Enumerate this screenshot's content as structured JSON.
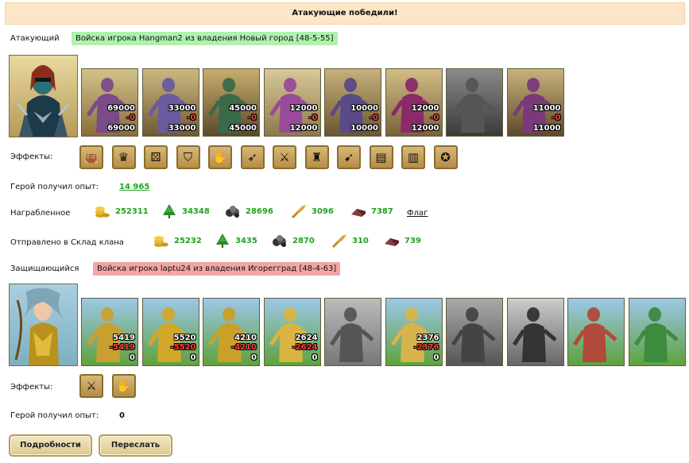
{
  "banner": "Атакующие победили!",
  "attacker": {
    "label": "Атакующий",
    "army": "Войска игрока Hangman2 из владения Новый город [48-5-55]",
    "units": [
      {
        "name": "unit-1",
        "total": "69000",
        "lost": "-0",
        "left": "69000"
      },
      {
        "name": "unit-2",
        "total": "33000",
        "lost": "-0",
        "left": "33000"
      },
      {
        "name": "unit-3",
        "total": "45000",
        "lost": "-0",
        "left": "45000"
      },
      {
        "name": "unit-4",
        "total": "12000",
        "lost": "-0",
        "left": "12000"
      },
      {
        "name": "unit-5",
        "total": "10000",
        "lost": "-0",
        "left": "10000"
      },
      {
        "name": "unit-6",
        "total": "12000",
        "lost": "-0",
        "left": "12000"
      },
      {
        "name": "unit-7",
        "total": "",
        "lost": "",
        "left": ""
      },
      {
        "name": "unit-8",
        "total": "11000",
        "lost": "-0",
        "left": "11000"
      }
    ],
    "effects_label": "Эффекты:",
    "effects": [
      "bag-icon",
      "crown-icon",
      "dice-icon",
      "shield-icon",
      "hand-icon",
      "horn-icon",
      "sword-icon",
      "armor-icon",
      "arrows-icon",
      "scroll-icon",
      "barrel-icon",
      "xp-icon"
    ],
    "xp_label": "Герой получил опыт:",
    "xp_value": "14 965",
    "loot_label": "Награбленное",
    "loot": {
      "gold": "252311",
      "wood": "34348",
      "ore": "28696",
      "grain": "3096",
      "stone": "7387"
    },
    "flag_link": "Флаг",
    "clan_label": "Отправлено в Склад клана",
    "clan": {
      "gold": "25232",
      "wood": "3435",
      "ore": "2870",
      "grain": "310",
      "stone": "739"
    }
  },
  "defender": {
    "label": "Защищающийся",
    "army": "Войска игрока laptu24 из владения Игорегград [48-4-63]",
    "units": [
      {
        "name": "unit-1",
        "total": "5419",
        "lost": "-5419",
        "left": "0"
      },
      {
        "name": "unit-2",
        "total": "5520",
        "lost": "-5520",
        "left": "0"
      },
      {
        "name": "unit-3",
        "total": "4210",
        "lost": "-4210",
        "left": "0"
      },
      {
        "name": "unit-4",
        "total": "2624",
        "lost": "-2624",
        "left": "0"
      },
      {
        "name": "unit-5",
        "total": "",
        "lost": "",
        "left": ""
      },
      {
        "name": "unit-6",
        "total": "2376",
        "lost": "-2376",
        "left": "0"
      },
      {
        "name": "unit-7",
        "total": "",
        "lost": "",
        "left": ""
      },
      {
        "name": "unit-8",
        "total": "",
        "lost": "",
        "left": ""
      },
      {
        "name": "unit-9",
        "total": "",
        "lost": "",
        "left": ""
      },
      {
        "name": "unit-10",
        "total": "",
        "lost": "",
        "left": ""
      }
    ],
    "effects_label": "Эффекты:",
    "effects": [
      "sword-icon",
      "handshake-icon"
    ],
    "xp_label": "Герой получил опыт:",
    "xp_value": "0"
  },
  "buttons": {
    "details": "Подробности",
    "forward": "Переслать"
  },
  "colors": {
    "banner": "#fde5c8",
    "attacker_tag": "#aef2ae",
    "defender_tag": "#f3a6a6",
    "resource_value": "#1ea31e",
    "loss": "#ff4040"
  }
}
